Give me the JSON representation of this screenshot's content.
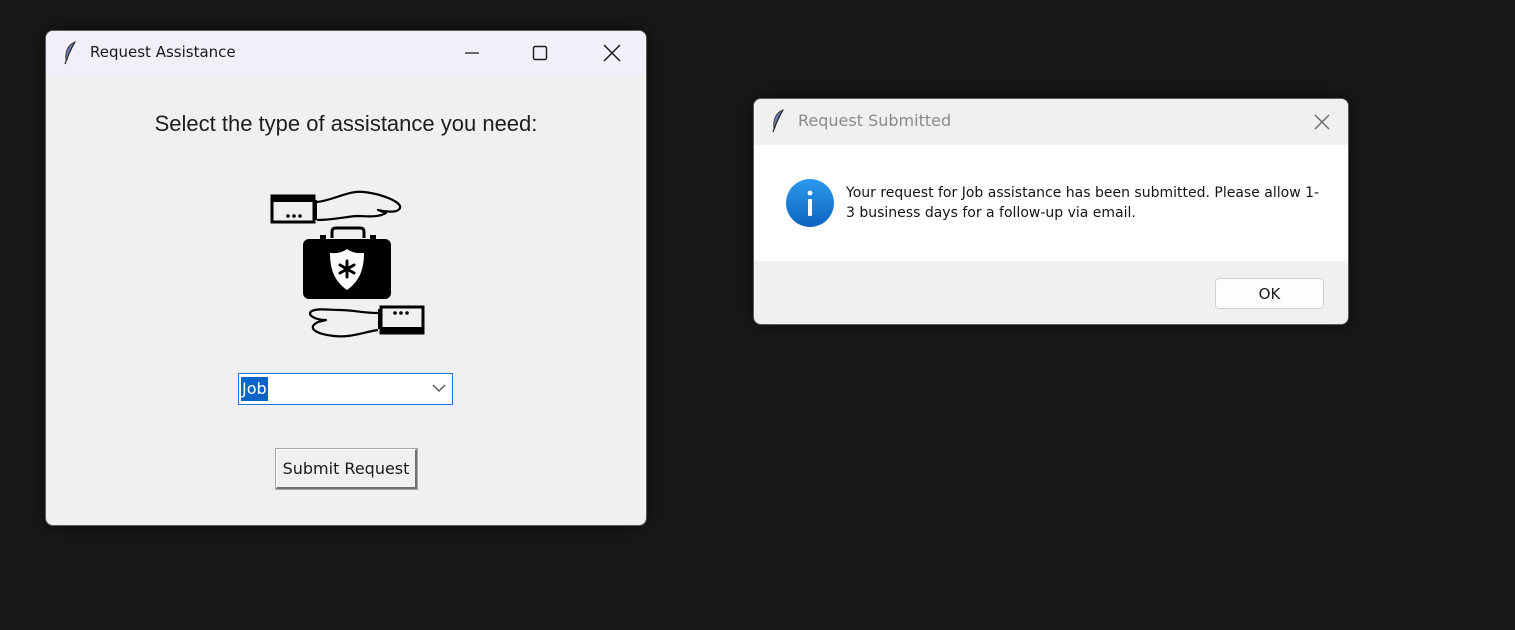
{
  "main_window": {
    "title": "Request Assistance",
    "prompt": "Select the type of assistance you need:",
    "assistance_type": {
      "selected": "Job"
    },
    "submit_label": "Submit Request",
    "icons": {
      "app": "feather-icon",
      "minimize": "minimize-icon",
      "maximize": "maximize-icon",
      "close": "close-icon",
      "illustration": "hands-briefcase-icon",
      "dropdown": "chevron-down-icon"
    }
  },
  "dialog": {
    "title": "Request Submitted",
    "message": "Your request for Job assistance has been submitted. Please allow 1-3 business days for a follow-up via email.",
    "ok_label": "OK",
    "icons": {
      "app": "feather-icon",
      "close": "close-icon",
      "status": "info-icon"
    }
  },
  "colors": {
    "desktop": "#181818",
    "selection": "#0a64c8",
    "focus_border": "#1b78d6",
    "info_blue": "#1a7fd8"
  }
}
